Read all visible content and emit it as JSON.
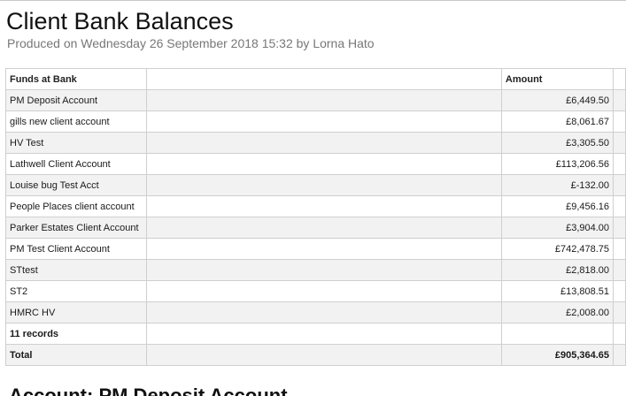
{
  "report": {
    "title": "Client Bank Balances",
    "subtitle": "Produced on Wednesday 26 September 2018 15:32 by Lorna Hato"
  },
  "table": {
    "headers": {
      "name": "Funds at Bank",
      "amount": "Amount"
    },
    "rows": [
      {
        "name": "PM Deposit Account",
        "amount": "£6,449.50"
      },
      {
        "name": "gills new client account",
        "amount": "£8,061.67"
      },
      {
        "name": "HV Test",
        "amount": "£3,305.50"
      },
      {
        "name": "Lathwell Client Account",
        "amount": "£113,206.56"
      },
      {
        "name": "Louise bug Test Acct",
        "amount": "£-132.00"
      },
      {
        "name": "People Places client account",
        "amount": "£9,456.16"
      },
      {
        "name": "Parker Estates Client Account",
        "amount": "£3,904.00"
      },
      {
        "name": "PM Test Client Account",
        "amount": "£742,478.75"
      },
      {
        "name": "STtest",
        "amount": "£2,818.00"
      },
      {
        "name": "ST2",
        "amount": "£13,808.51"
      },
      {
        "name": "HMRC HV",
        "amount": "£2,008.00"
      }
    ],
    "records_label": "11 records",
    "total_label": "Total",
    "total_amount": "£905,364.65"
  },
  "next_section": {
    "heading": "Account: PM Deposit Account"
  }
}
